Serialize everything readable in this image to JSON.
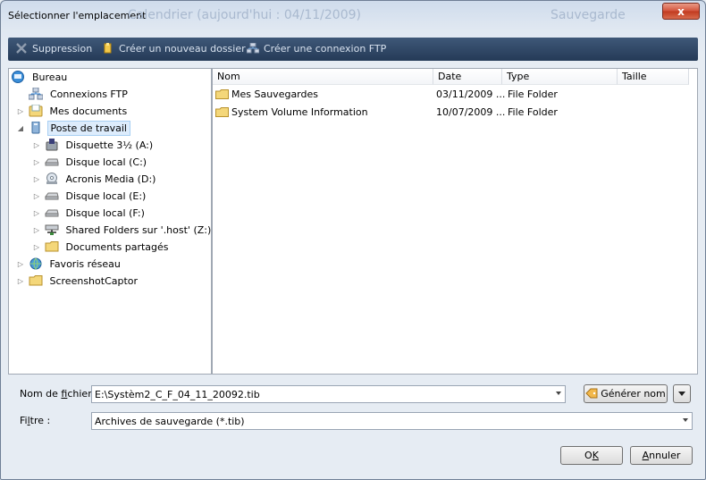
{
  "window": {
    "title": "Sélectionner l'emplacement",
    "ghost_calendar": "Calendrier (aujourd'hui : 04/11/2009)",
    "ghost_backup": "Sauvegarde",
    "close_label": "x"
  },
  "toolbar": {
    "delete_label": "Suppression",
    "new_folder_label": "Créer un nouveau dossier",
    "ftp_label": "Créer une connexion FTP"
  },
  "tree": {
    "items": [
      {
        "label": "Bureau",
        "icon": "desktop-icon"
      },
      {
        "label": "Connexions FTP",
        "icon": "ftp-connections-icon"
      },
      {
        "label": "Mes documents",
        "icon": "documents-icon"
      },
      {
        "label": "Poste de travail",
        "icon": "computer-icon"
      },
      {
        "label": "Disquette 3½ (A:)",
        "icon": "floppy-icon"
      },
      {
        "label": "Disque local (C:)",
        "icon": "hard-drive-icon"
      },
      {
        "label": "Acronis Media (D:)",
        "icon": "cd-drive-icon"
      },
      {
        "label": "Disque local (E:)",
        "icon": "hard-drive-icon"
      },
      {
        "label": "Disque local (F:)",
        "icon": "hard-drive-icon"
      },
      {
        "label": "Shared Folders sur '.host' (Z:)",
        "icon": "network-drive-icon"
      },
      {
        "label": "Documents partagés",
        "icon": "folder-icon"
      },
      {
        "label": "Favoris réseau",
        "icon": "network-icon"
      },
      {
        "label": "ScreenshotCaptor",
        "icon": "folder-icon"
      }
    ]
  },
  "list": {
    "columns": [
      "Nom",
      "Date",
      "Type",
      "Taille"
    ],
    "rows": [
      {
        "name": "Mes Sauvegardes",
        "date": "03/11/2009 ...",
        "type": "File Folder",
        "size": ""
      },
      {
        "name": "System Volume Information",
        "date": "10/07/2009 ...",
        "type": "File Folder",
        "size": ""
      }
    ]
  },
  "form": {
    "filename_label_pre": "Nom de ",
    "filename_label_key": "f",
    "filename_label_post": "ichier :",
    "filename_value": "E:\\Systèm2_C_F_04_11_20092.tib",
    "generate_label": "Générer nom",
    "filter_label_pre": "Fi",
    "filter_label_key": "l",
    "filter_label_post": "tre :",
    "filter_value": "Archives de sauvegarde (*.tib)"
  },
  "buttons": {
    "ok_pre": "O",
    "ok_key": "K",
    "cancel_key": "A",
    "cancel_post": "nnuler"
  }
}
